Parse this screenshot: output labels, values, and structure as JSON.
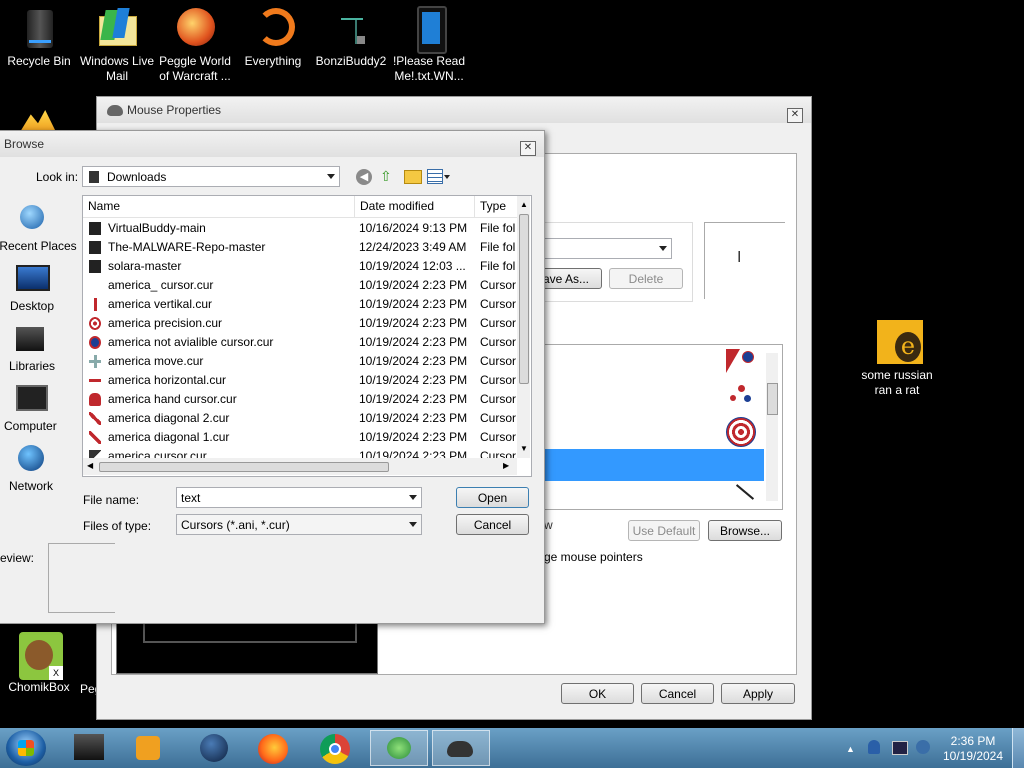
{
  "desktop": {
    "icons_top": [
      {
        "label": "Recycle Bin"
      },
      {
        "label": "Windows Live Mail"
      },
      {
        "label": "Peggle World of Warcraft ..."
      },
      {
        "label": "Everything"
      },
      {
        "label": "BonziBuddy2"
      },
      {
        "label": "!Please Read Me!.txt.WN..."
      }
    ],
    "icon_right": {
      "label": "some russian ran a rat"
    },
    "icon_bottom": {
      "label": "ChomikBox"
    },
    "icon_bottom_partial": {
      "label": "Peg"
    }
  },
  "mouse_properties": {
    "title": "Mouse Properties",
    "save_as": "ave As...",
    "delete": "Delete",
    "use_default": "Use Default",
    "browse": "Browse...",
    "partial_w": "w",
    "partial_pointers": "ge mouse pointers",
    "ok": "OK",
    "cancel": "Cancel",
    "apply": "Apply"
  },
  "browse_dialog": {
    "title": "Browse",
    "look_in_label": "Look in:",
    "look_in_value": "Downloads",
    "places": [
      {
        "label": "Recent Places"
      },
      {
        "label": "Desktop"
      },
      {
        "label": "Libraries"
      },
      {
        "label": "Computer"
      },
      {
        "label": "Network"
      }
    ],
    "columns": {
      "name": "Name",
      "date": "Date modified",
      "type": "Type"
    },
    "files": [
      {
        "name": "VirtualBuddy-main",
        "date": "10/16/2024 9:13 PM",
        "type": "File fol",
        "icon": "folder-icon"
      },
      {
        "name": "The-MALWARE-Repo-master",
        "date": "12/24/2023 3:49 AM",
        "type": "File fol",
        "icon": "folder-icon"
      },
      {
        "name": "solara-master",
        "date": "10/19/2024 12:03 ...",
        "type": "File fol",
        "icon": "folder-icon"
      },
      {
        "name": "america_ cursor.cur",
        "date": "10/19/2024 2:23 PM",
        "type": "Cursor",
        "icon": "help-cursor-icon"
      },
      {
        "name": "america vertikal.cur",
        "date": "10/19/2024 2:23 PM",
        "type": "Cursor",
        "icon": "vertical-cursor-icon"
      },
      {
        "name": "america precision.cur",
        "date": "10/19/2024 2:23 PM",
        "type": "Cursor",
        "icon": "precision-cursor-icon"
      },
      {
        "name": "america not avialible cursor.cur",
        "date": "10/19/2024 2:23 PM",
        "type": "Cursor",
        "icon": "not-available-cursor-icon"
      },
      {
        "name": "america move.cur",
        "date": "10/19/2024 2:23 PM",
        "type": "Cursor",
        "icon": "move-cursor-icon"
      },
      {
        "name": "america horizontal.cur",
        "date": "10/19/2024 2:23 PM",
        "type": "Cursor",
        "icon": "horizontal-cursor-icon"
      },
      {
        "name": "america hand cursor.cur",
        "date": "10/19/2024 2:23 PM",
        "type": "Cursor",
        "icon": "hand-cursor-icon"
      },
      {
        "name": "america diagonal 2.cur",
        "date": "10/19/2024 2:23 PM",
        "type": "Cursor",
        "icon": "diagonal-cursor-icon"
      },
      {
        "name": "america diagonal 1.cur",
        "date": "10/19/2024 2:23 PM",
        "type": "Cursor",
        "icon": "diagonal-cursor-icon"
      },
      {
        "name": "america cursor.cur",
        "date": "10/19/2024 2:23 PM",
        "type": "Cursor",
        "icon": "arrow-cursor-icon"
      }
    ],
    "file_name_label": "File name:",
    "file_name_value": "text",
    "files_of_type_label": "Files of type:",
    "files_of_type_value": "Cursors (*.ani, *.cur)",
    "open": "Open",
    "cancel": "Cancel",
    "preview_label": "eview:"
  },
  "taskbar": {
    "time": "2:36 PM",
    "date": "10/19/2024"
  },
  "colors": {
    "selection": "#3399ff",
    "taskbar": "#5289b3"
  }
}
